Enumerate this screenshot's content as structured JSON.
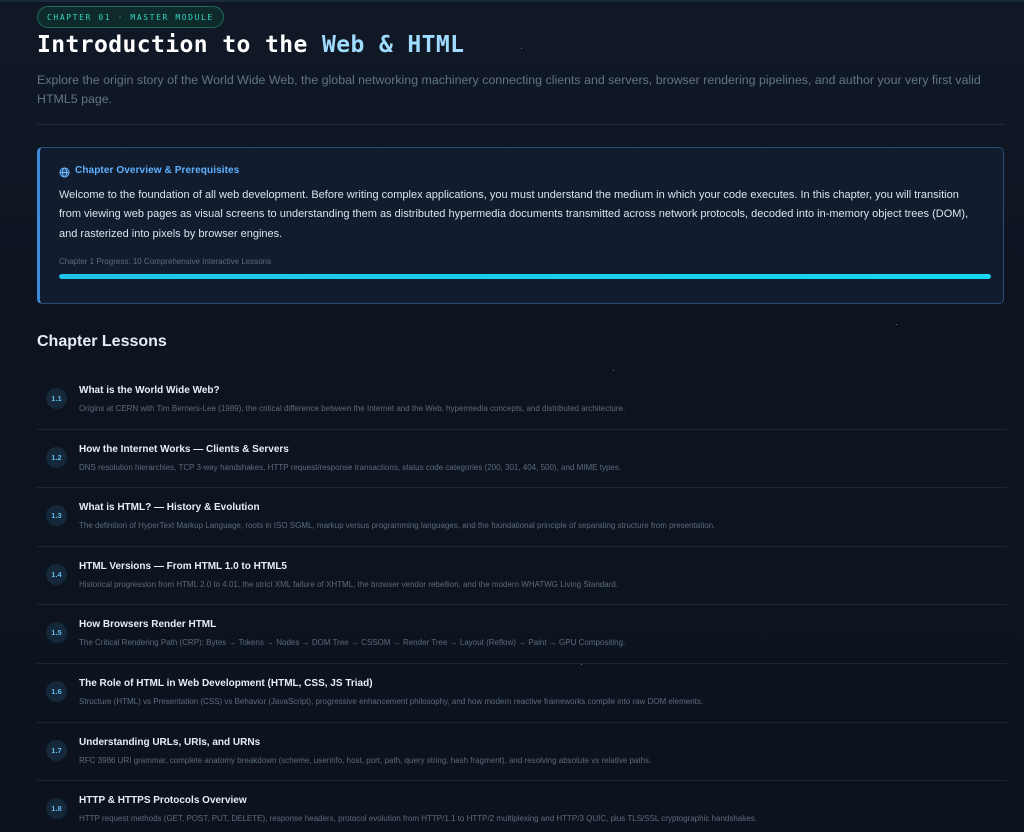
{
  "header": {
    "badge": "CHAPTER 01 · MASTER MODULE",
    "title_main": "Introduction to the ",
    "title_accent": "Web & HTML",
    "subtitle": "Explore the origin story of the World Wide Web, the global networking machinery connecting clients and servers, browser rendering pipelines, and author your very first valid HTML5 page."
  },
  "overview": {
    "icon": "globe-icon",
    "title": "Chapter Overview & Prerequisites",
    "body": "Welcome to the foundation of all web development. Before writing complex applications, you must understand the medium in which your code executes. In this chapter, you will transition from viewing web pages as visual screens to understanding them as distributed hypermedia documents transmitted across network protocols, decoded into in-memory object trees (DOM), and rasterized into pixels by browser engines.",
    "progress_label": "Chapter 1 Progress: 10 Comprehensive Interactive Lessons",
    "progress_fraction": 1.0
  },
  "lessons_section": {
    "title": "Chapter Lessons",
    "items": [
      {
        "num": "1.1",
        "title": "What is the World Wide Web?",
        "desc": "Origins at CERN with Tim Berners-Lee (1989), the critical difference between the Internet and the Web, hypermedia concepts, and distributed architecture."
      },
      {
        "num": "1.2",
        "title": "How the Internet Works — Clients & Servers",
        "desc": "DNS resolution hierarchies, TCP 3-way handshakes, HTTP request/response transactions, status code categories (200, 301, 404, 500), and MIME types."
      },
      {
        "num": "1.3",
        "title": "What is HTML? — History & Evolution",
        "desc": "The definition of HyperText Markup Language, roots in ISO SGML, markup versus programming languages, and the foundational principle of separating structure from presentation."
      },
      {
        "num": "1.4",
        "title": "HTML Versions — From HTML 1.0 to HTML5",
        "desc": "Historical progression from HTML 2.0 to 4.01, the strict XML failure of XHTML, the browser vendor rebellion, and the modern WHATWG Living Standard."
      },
      {
        "num": "1.5",
        "title": "How Browsers Render HTML",
        "desc": "The Critical Rendering Path (CRP): Bytes → Tokens → Nodes → DOM Tree → CSSOM → Render Tree → Layout (Reflow) → Paint → GPU Compositing."
      },
      {
        "num": "1.6",
        "title": "The Role of HTML in Web Development (HTML, CSS, JS Triad)",
        "desc": "Structure (HTML) vs Presentation (CSS) vs Behavior (JavaScript), progressive enhancement philosophy, and how modern reactive frameworks compile into raw DOM elements."
      },
      {
        "num": "1.7",
        "title": "Understanding URLs, URIs, and URNs",
        "desc": "RFC 3986 URI grammar, complete anatomy breakdown (scheme, userinfo, host, port, path, query string, hash fragment), and resolving absolute vs relative paths."
      },
      {
        "num": "1.8",
        "title": "HTTP & HTTPS Protocols Overview",
        "desc": "HTTP request methods (GET, POST, PUT, DELETE), response headers, protocol evolution from HTTP/1.1 to HTTP/2 multiplexing and HTTP/3 QUIC, plus TLS/SSL cryptographic handshakes."
      }
    ]
  }
}
